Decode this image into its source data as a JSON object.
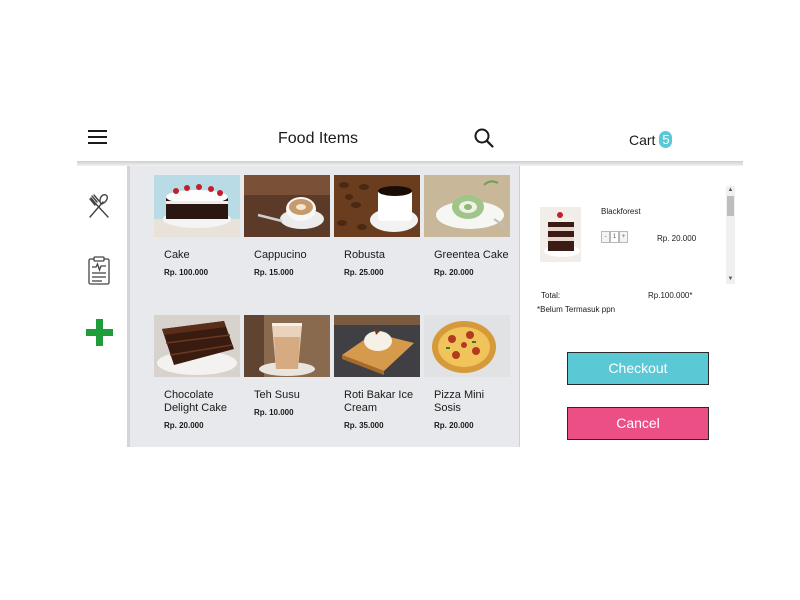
{
  "header": {
    "title": "Food Items",
    "cart_label": "Cart",
    "cart_count": "5"
  },
  "sidebar": {
    "items": [
      {
        "icon": "utensils-icon"
      },
      {
        "icon": "clipboard-icon"
      },
      {
        "icon": "plus-icon"
      }
    ]
  },
  "menu": {
    "items": [
      {
        "name": "Cake",
        "price": "Rp. 100.000"
      },
      {
        "name": "Cappucino",
        "price": "Rp. 15.000"
      },
      {
        "name": "Robusta",
        "price": "Rp. 25.000"
      },
      {
        "name": "Greentea Cake",
        "price": "Rp. 20.000"
      },
      {
        "name": "Chocolate Delight Cake",
        "price": "Rp. 20.000"
      },
      {
        "name": "Teh Susu",
        "price": "Rp. 10.000"
      },
      {
        "name": "Roti Bakar Ice Cream",
        "price": "Rp. 35.000"
      },
      {
        "name": "Pizza Mini Sosis",
        "price": "Rp. 20.000"
      }
    ]
  },
  "cart": {
    "item": {
      "name": "Blackforest",
      "qty_minus": "-",
      "qty": "1",
      "qty_plus": "+",
      "price": "Rp. 20.000"
    },
    "total_label": "Total:",
    "total_value": "Rp.100.000*",
    "tax_note": "*Belum Termasuk ppn",
    "checkout_label": "Checkout",
    "cancel_label": "Cancel"
  },
  "colors": {
    "accent_teal": "#5bc9d5",
    "cancel_pink": "#ec4f86",
    "add_green": "#1f9d3a",
    "grid_bg": "#e8e9ec"
  }
}
